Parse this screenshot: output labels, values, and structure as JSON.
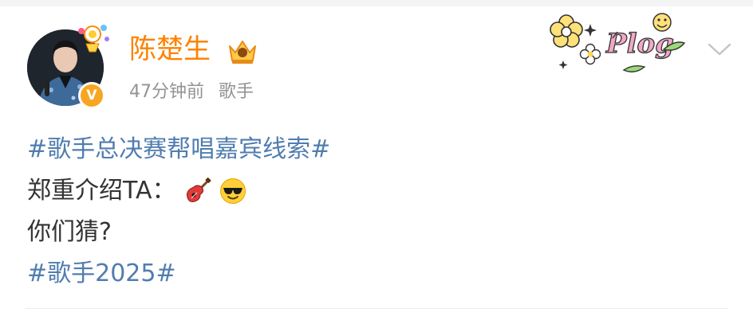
{
  "post": {
    "author": {
      "name": "陈楚生",
      "badge_icon": "crown-badge-icon",
      "verified_icon": "verified-v-icon"
    },
    "time": "47分钟前",
    "source": "歌手",
    "sticker_text": "Plog",
    "menu_icon": "chevron-down-icon",
    "content": {
      "topic1": "#歌手总决赛帮唱嘉宾线索#",
      "line2": "郑重介绍TA：",
      "emoji1": "guitar-emoji",
      "emoji2": "cool-sunglasses-emoji",
      "line3": "你们猜?",
      "topic2": "#歌手2025#"
    },
    "colors": {
      "author_name": "#ff8200",
      "topic_link": "#507daf",
      "meta_text": "#939393",
      "body_text": "#333333",
      "verified": "#f6a623"
    }
  }
}
